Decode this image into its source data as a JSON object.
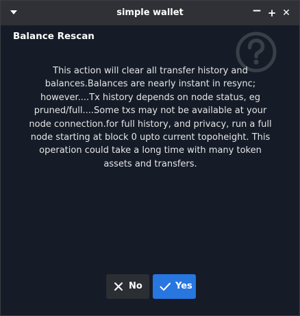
{
  "window": {
    "title": "simple wallet",
    "controls": {
      "menu_icon": "chevron-down-icon",
      "minimize": "−",
      "maximize": "+",
      "close": "✕"
    }
  },
  "dialog": {
    "heading": "Balance Rescan",
    "help_icon": "question-circle-icon",
    "message": "This action will clear all transfer history and balances.Balances are nearly instant in resync; however....Tx history depends on node status, eg pruned/full....Some txs may not be available at your node connection.for full history, and privacy, run a full node starting at block 0 upto current topoheight. This operation could take a long time with many token assets and transfers.",
    "buttons": {
      "no": {
        "label": "No",
        "icon": "close-icon"
      },
      "yes": {
        "label": "Yes",
        "icon": "check-icon"
      }
    }
  },
  "colors": {
    "background": "#151b27",
    "titlebar": "#2f3136",
    "accent": "#2876e0",
    "secondary_button": "#2b2e33"
  }
}
